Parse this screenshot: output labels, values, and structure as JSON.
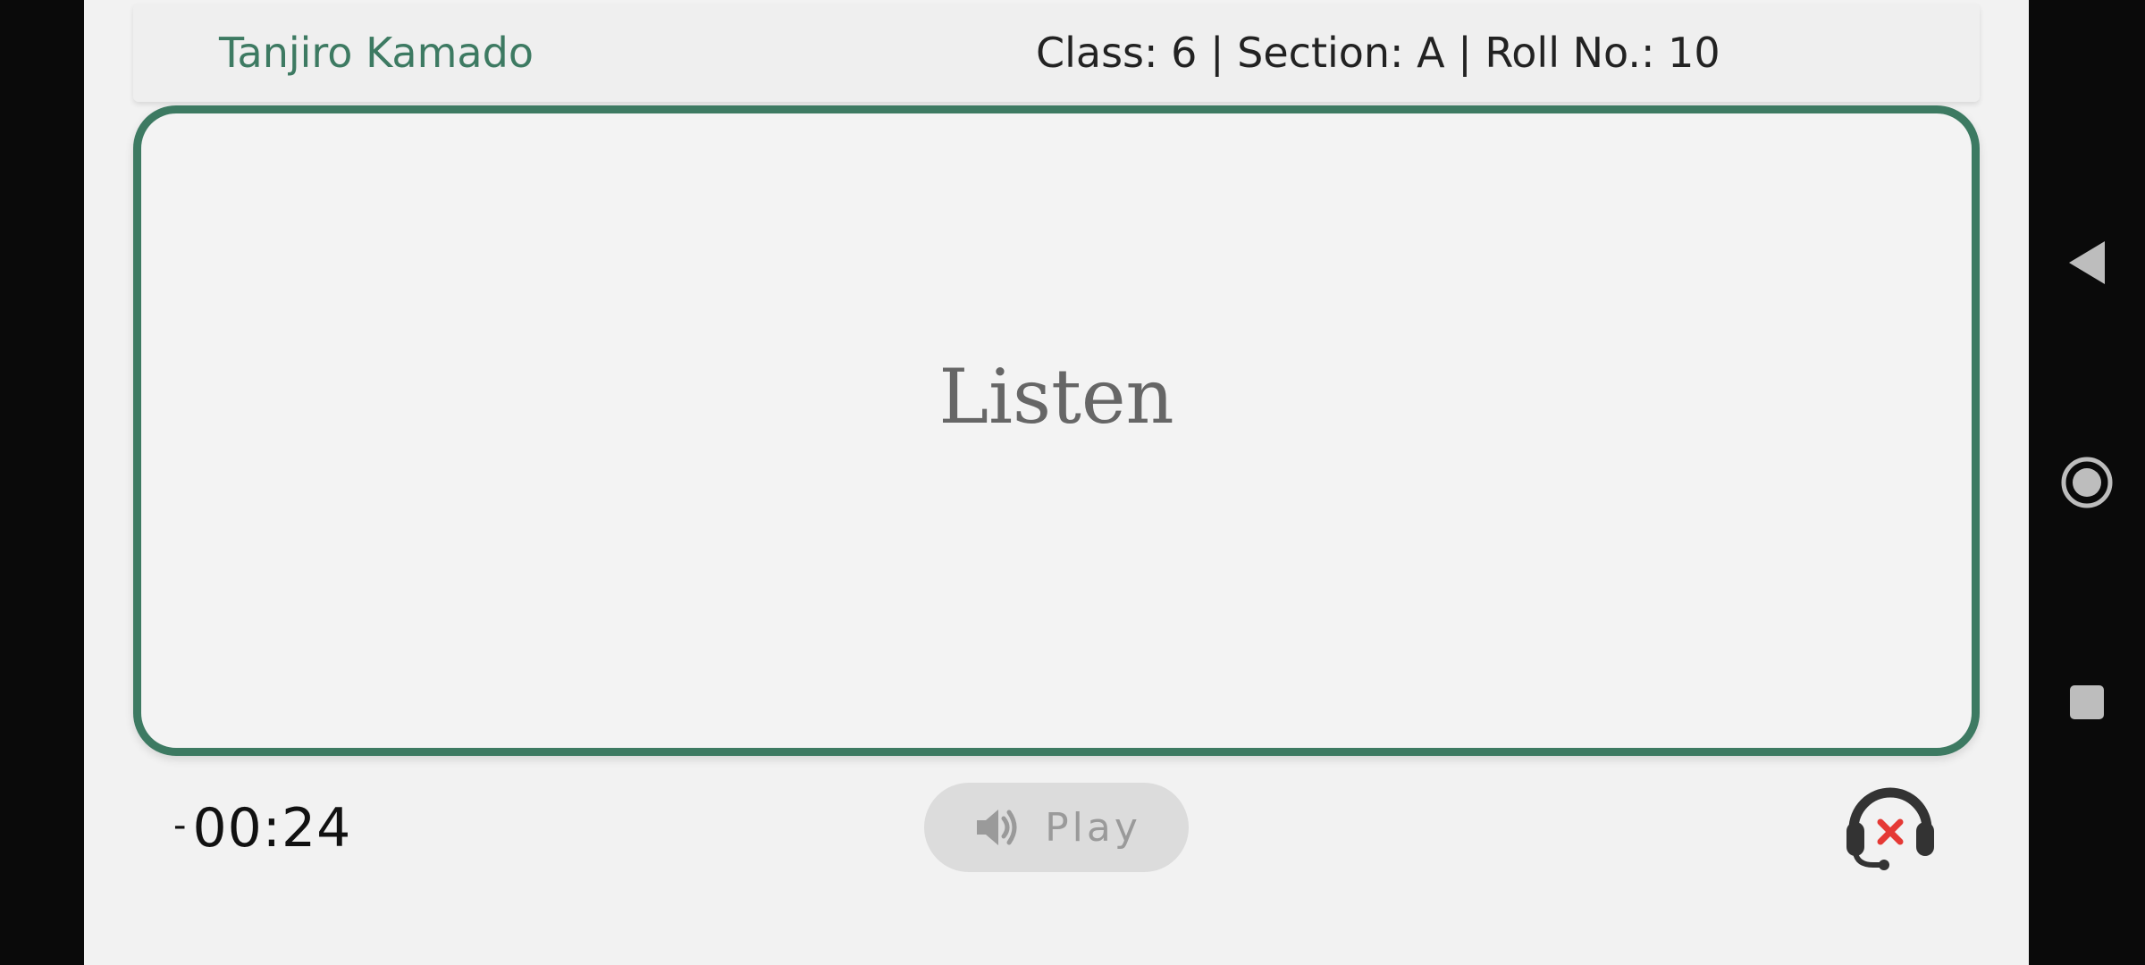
{
  "header": {
    "student_name": "Tanjiro Kamado",
    "class_info": "Class: 6 | Section: A | Roll No.: 10"
  },
  "card": {
    "word": "Listen"
  },
  "controls": {
    "timer_prefix": "-",
    "timer_value": "00:24",
    "play_label": "Play",
    "play_icon": "speaker-icon",
    "headset_icon": "headset-muted-icon"
  },
  "colors": {
    "accent": "#3d7a62",
    "background": "#f2f2f2",
    "error": "#e53935"
  },
  "system_nav": {
    "back_icon": "back-triangle-icon",
    "home_icon": "home-circle-icon",
    "recents_icon": "recents-square-icon"
  }
}
